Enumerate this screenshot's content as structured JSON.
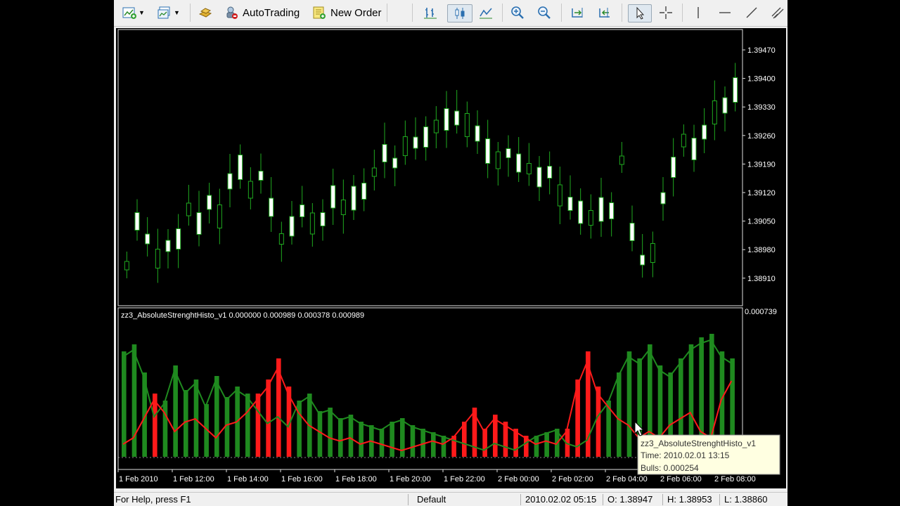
{
  "toolbar": {
    "autotrading_label": "AutoTrading",
    "new_order_label": "New Order"
  },
  "price_chart": {
    "price_labels": [
      "1.39470",
      "1.39400",
      "1.39330",
      "1.39260",
      "1.39190",
      "1.39120",
      "1.39050",
      "1.38980",
      "1.38910"
    ]
  },
  "indicator": {
    "header": "zz3_AbsoluteStrenghtHisto_v1 0.000000 0.000989 0.000378 0.000989",
    "scale_top": "0.000739",
    "colors": {
      "bulls": "#1f8a1f",
      "bears": "#ff1a1a"
    }
  },
  "time_axis": {
    "labels": [
      "1 Feb 2010",
      "1 Feb 12:00",
      "1 Feb 14:00",
      "1 Feb 16:00",
      "1 Feb 18:00",
      "1 Feb 20:00",
      "1 Feb 22:00",
      "2 Feb 00:00",
      "2 Feb 02:00",
      "2 Feb 04:00",
      "2 Feb 06:00",
      "2 Feb 08:00"
    ]
  },
  "tooltip": {
    "title": "zz3_AbsoluteStrenghtHisto_v1",
    "time": "Time: 2010.02.01 13:15",
    "bulls": "Bulls: 0.000254"
  },
  "statusbar": {
    "help": "For Help, press F1",
    "profile": "Default",
    "datetime": "2010.02.02 05:15",
    "open": "O: 1.38947",
    "high": "H: 1.38953",
    "low": "L: 1.38860"
  }
}
